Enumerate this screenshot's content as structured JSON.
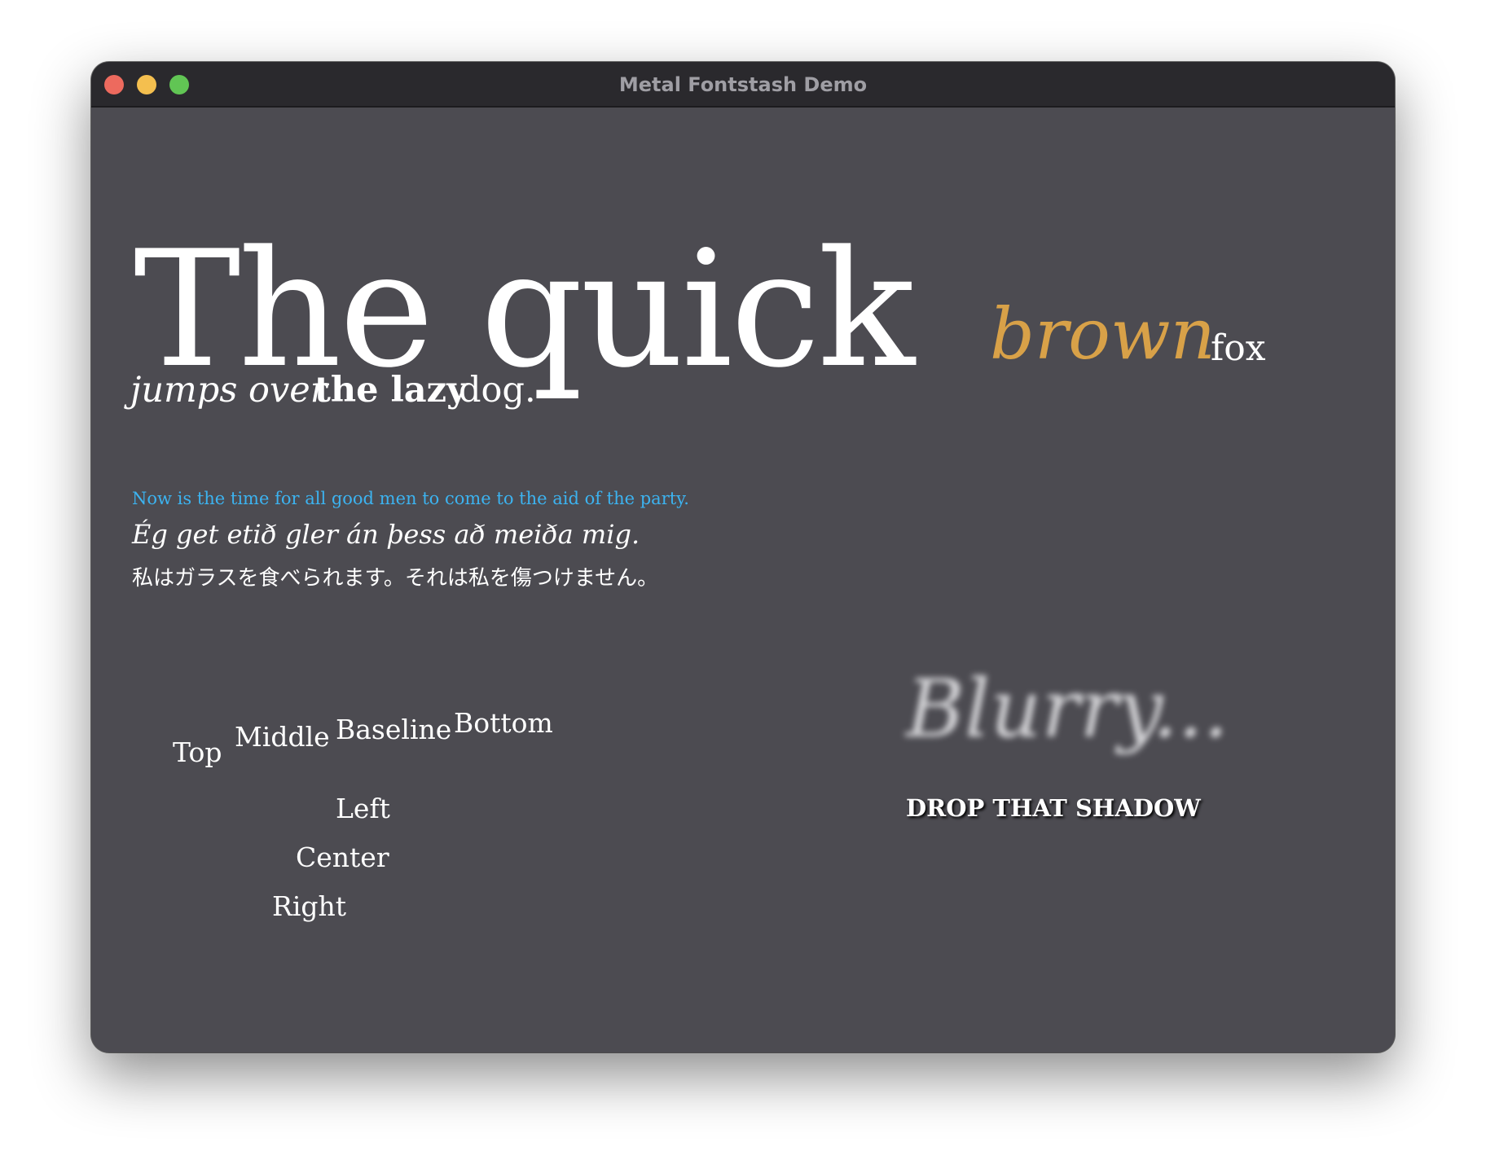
{
  "window": {
    "title": "Metal Fontstash Demo"
  },
  "headline": {
    "big": "The quick",
    "brown": "brown",
    "fox": "fox",
    "jumps_over": "jumps over",
    "the_lazy": "the lazy",
    "dog": "dog."
  },
  "lines": {
    "now_is_the_time": "Now is the time for all good men to come to the aid of the party.",
    "icelandic": "Ég get etið gler án þess að meiða mig.",
    "japanese": "私はガラスを食べられます。それは私を傷つけません。"
  },
  "vertical_align": {
    "top": "Top",
    "middle": "Middle",
    "baseline": "Baseline",
    "bottom": "Bottom"
  },
  "horizontal_align": {
    "left": "Left",
    "center": "Center",
    "right": "Right"
  },
  "effects": {
    "blurry": "Blurry...",
    "shadow": "DROP THAT SHADOW"
  },
  "colors": {
    "background": "#4c4b51",
    "titlebar": "#2a292d",
    "text": "#ffffff",
    "brown": "#d8a148",
    "blue": "#3cb3f0",
    "close": "#ed6a5e",
    "minimize": "#f4bf4f",
    "maximize": "#61c554"
  }
}
